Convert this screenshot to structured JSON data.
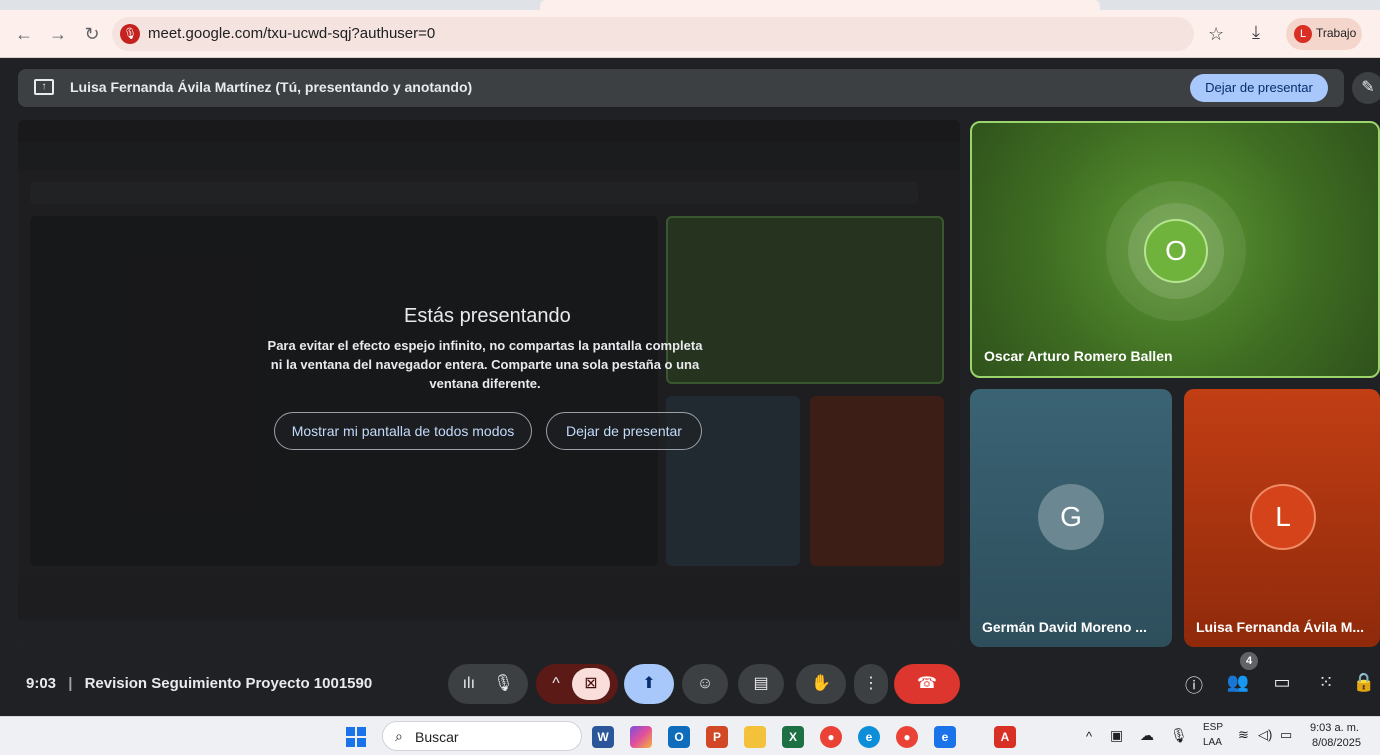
{
  "browser": {
    "url": "meet.google.com/txu-ucwd-sqj?authuser=0",
    "profile_initial": "L",
    "profile_name": "Trabajo"
  },
  "present_banner": {
    "title": "Luisa Fernanda Ávila Martínez (Tú, presentando y anotando)",
    "stop_label": "Dejar de presentar"
  },
  "dialog": {
    "title": "Estás presentando",
    "body": "Para evitar el efecto espejo infinito, no compartas la pantalla completa ni la ventana del navegador entera. Comparte una sola pestaña o una ventana diferente.",
    "show_anyway_label": "Mostrar mi pantalla de todos modos",
    "stop_label": "Dejar de presentar"
  },
  "participants": [
    {
      "initial": "O",
      "name": "Oscar Arturo Romero Ballen",
      "color": "#4b8a2a"
    },
    {
      "initial": "G",
      "name": "Germán David Moreno ...",
      "color": "#3a5f6e"
    },
    {
      "initial": "L",
      "name": "Luisa Fernanda Ávila M...",
      "color": "#b8300f"
    }
  ],
  "meeting": {
    "time": "9:03",
    "title": "Revision Seguimiento Proyecto 1001590",
    "participant_count": "4"
  },
  "taskbar": {
    "search_label": "Buscar",
    "lang_top": "ESP",
    "lang_bottom": "LAA",
    "time": "9:03 a. m.",
    "date": "8/08/2025"
  }
}
